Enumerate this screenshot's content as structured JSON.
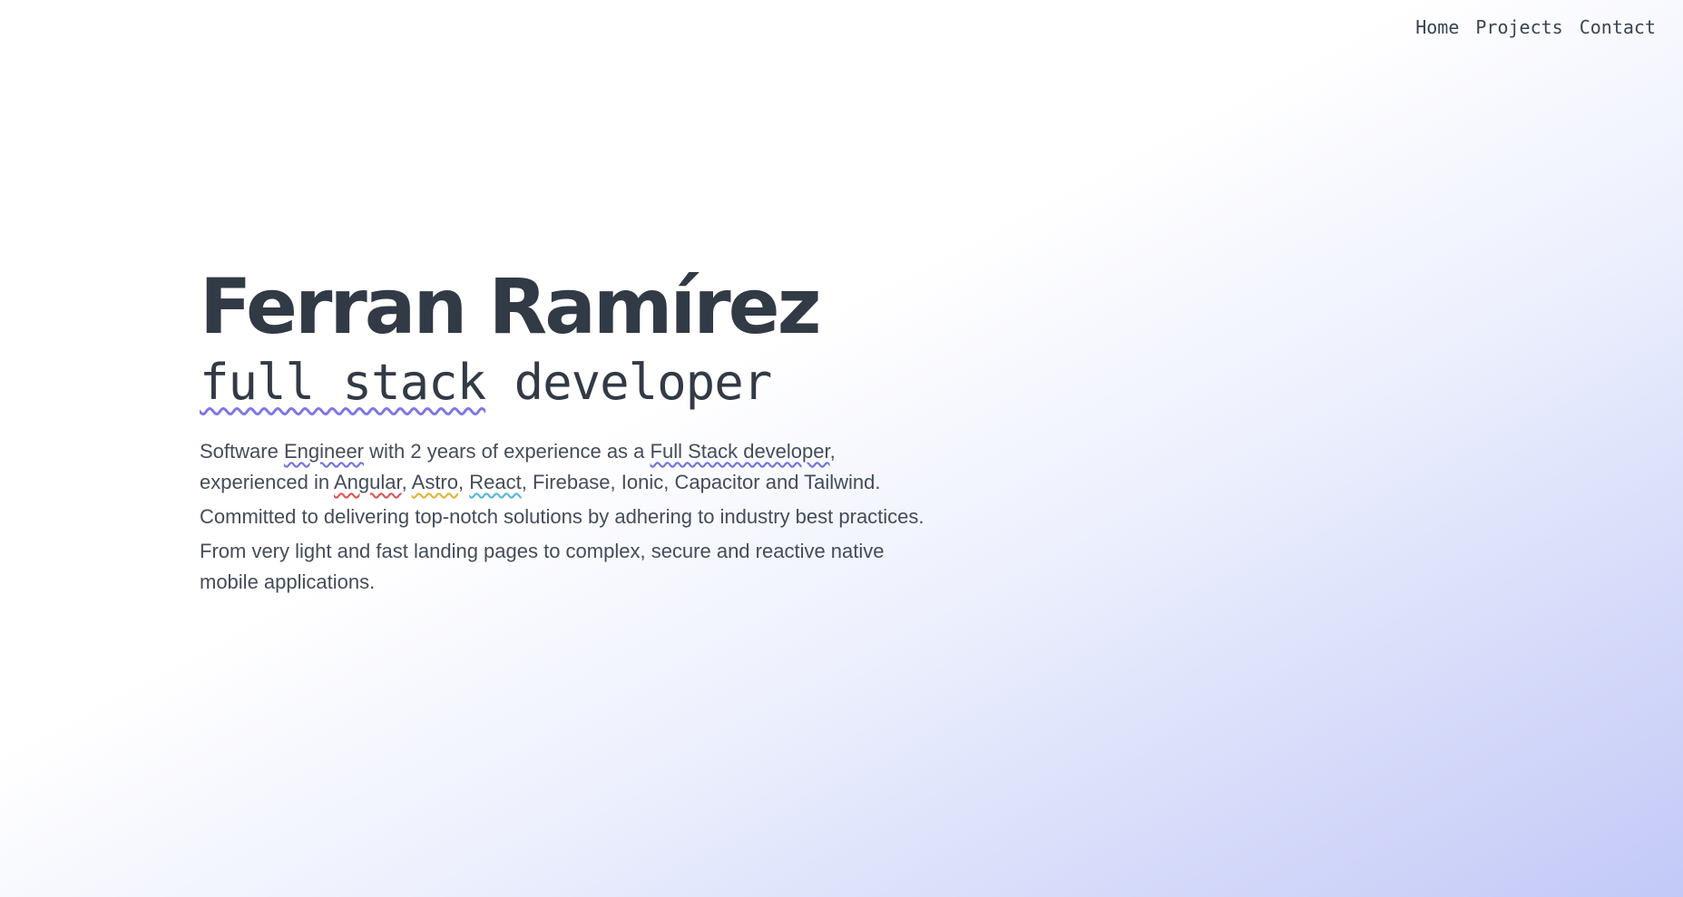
{
  "nav": {
    "home": "Home",
    "projects": "Projects",
    "contact": "Contact"
  },
  "hero": {
    "name": "Ferran Ramírez",
    "role_highlight": "full stack",
    "role_rest": " developer",
    "bio": {
      "p1_a": "Software ",
      "p1_engineer": "Engineer",
      "p1_b": " with 2 years of experience as a ",
      "p1_fullstack": "Full Stack developer",
      "p1_c": ", experienced in ",
      "p1_angular": "Angular",
      "p1_sep1": ", ",
      "p1_astro": "Astro",
      "p1_sep2": ", ",
      "p1_react": "React",
      "p1_d": ", Firebase, Ionic, Capacitor and Tailwind.",
      "p2": "Committed to delivering top-notch solutions by adhering to industry best practices.",
      "p3": "From very light and fast landing pages to complex, secure and reactive native mobile applications."
    }
  },
  "colors": {
    "text": "#323a46",
    "accent_underline": "#7f77e6",
    "gradient_end": "#c3c9f7"
  }
}
